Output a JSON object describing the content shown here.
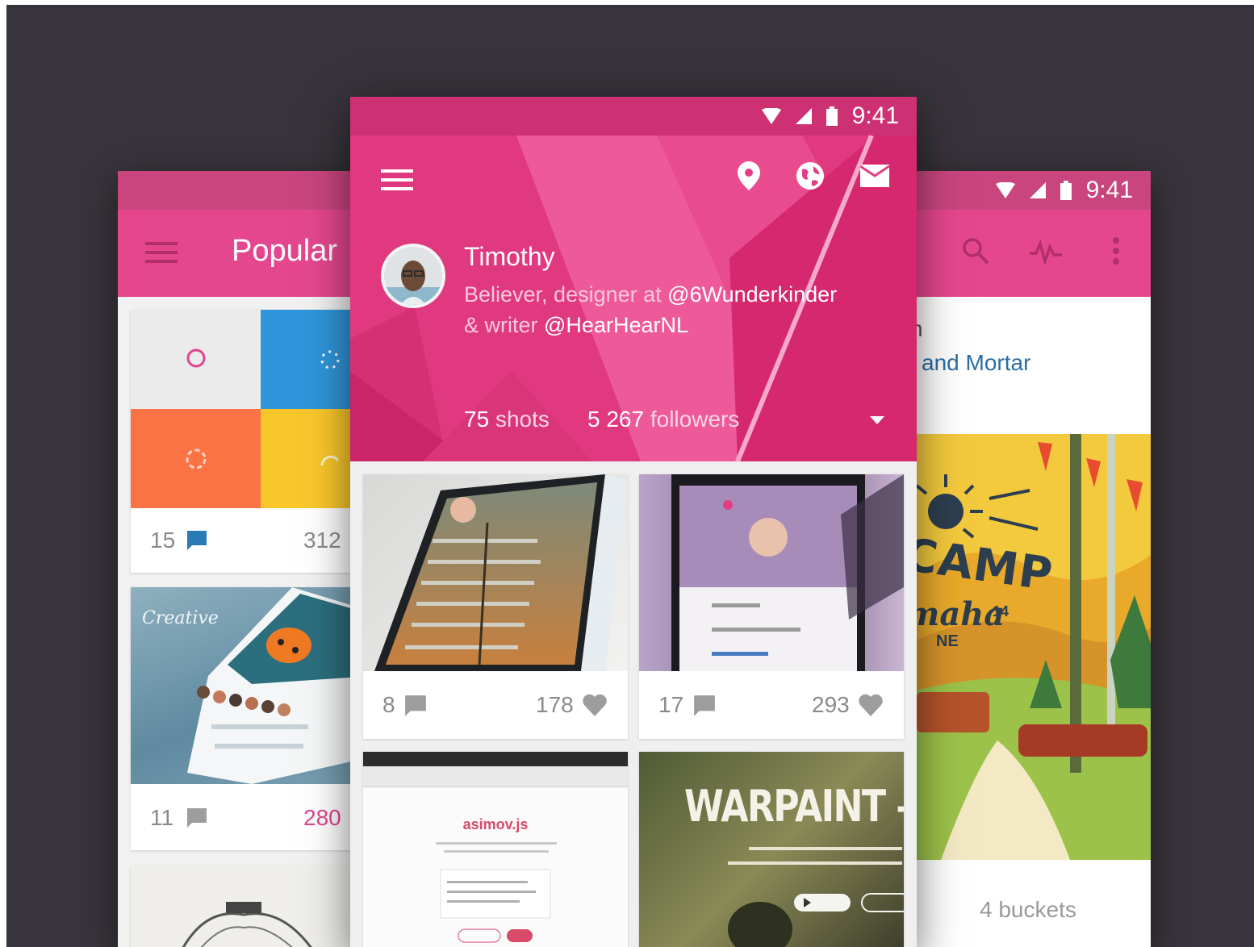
{
  "status": {
    "time": "9:41"
  },
  "left_screen": {
    "title": "Popular",
    "cards": [
      {
        "comments": "15",
        "likes": "312",
        "likes_highlight": false
      },
      {
        "comments": "11",
        "likes": "280",
        "likes_highlight": true
      }
    ],
    "card2_image_text": "Creative"
  },
  "center_screen": {
    "profile": {
      "name": "Timothy",
      "bio_line1_prefix": "Believer, designer at ",
      "bio_line1_handle": "@6Wunderkinder",
      "bio_line2_prefix": "& writer ",
      "bio_line2_handle": "@HearHearNL"
    },
    "stats": {
      "shots_count": "75",
      "shots_label": "shots",
      "followers_count": "5 267",
      "followers_label": "followers"
    },
    "shots": [
      {
        "comments": "8",
        "likes": "178"
      },
      {
        "comments": "17",
        "likes": "293"
      },
      {
        "title_text": "asimov.js"
      },
      {
        "title_text": "WARPAINT – W"
      }
    ]
  },
  "right_screen": {
    "subtitle_fragment_1": "n",
    "subtitle_fragment_2": "and Mortar",
    "poster_text_1": "CAMP",
    "poster_text_2": "maha",
    "poster_text_3": "14",
    "poster_text_4": "NE",
    "buckets": "4 buckets"
  },
  "colors": {
    "background": "#37343b",
    "primary": "#e5478e",
    "status_bar": "#c9457e"
  }
}
